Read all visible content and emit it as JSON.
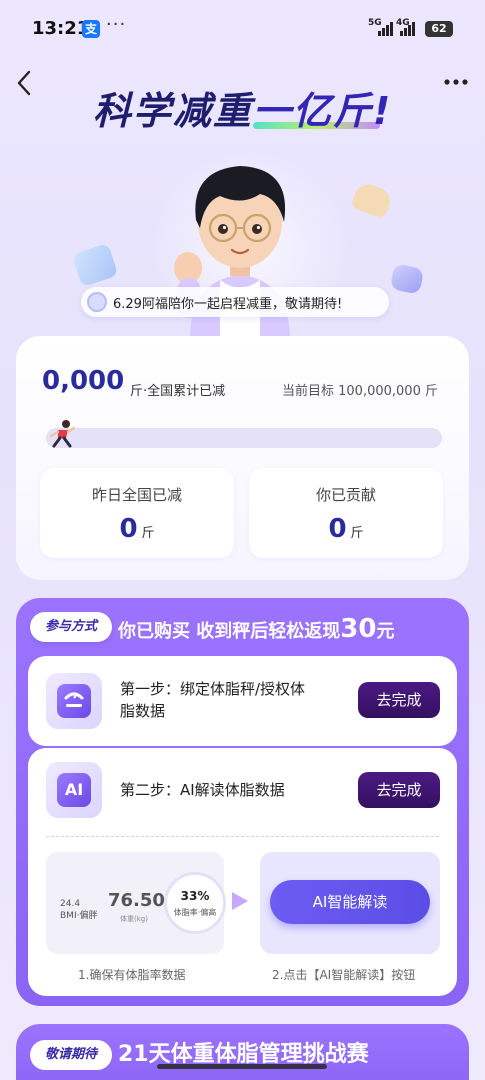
{
  "status_bar": {
    "time": "13:21",
    "app_badge": "支",
    "dots": "···",
    "net1": "5G",
    "net2": "4G",
    "battery": "62"
  },
  "hero": {
    "title_part1": "科学减重",
    "title_part2": "一亿斤!",
    "announcement": "6.29阿福陪你一起启程减重，敬请期待!"
  },
  "stats": {
    "total_value": "0,000",
    "total_unit_label": "斤·全国累计已减",
    "target_text": "当前目标 100,000,000 斤",
    "progress_fraction": 0.0,
    "yesterday_label": "昨日全国已减",
    "yesterday_value": "0",
    "yesterday_unit": "斤",
    "contributed_label": "你已贡献",
    "contributed_value": "0",
    "contributed_unit": "斤"
  },
  "participation": {
    "tag": "参与方式",
    "title_prefix": "你已购买 收到秤后轻松返现",
    "title_amount": "30",
    "title_suffix": "元",
    "step1": {
      "icon": "scale-icon",
      "text_line1": "第一步：绑定体脂秤/授权体",
      "text_line2": "脂数据",
      "button": "去完成"
    },
    "step2": {
      "icon": "ai-report-icon",
      "icon_text": "AI",
      "text_line1": "第二步：AI解读体脂数据",
      "button": "去完成"
    },
    "demo": {
      "bmi_value": "24.4",
      "bmi_label": "BMI·偏胖",
      "weight_value": "76.50",
      "weight_label": "体重(kg)",
      "fat_pct": "33%",
      "fat_label": "体脂率·偏高",
      "ai_button": "AI智能解读",
      "caption1": "1.确保有体脂率数据",
      "caption2": "2.点击【AI智能解读】按钮"
    }
  },
  "teaser": {
    "tag": "敬请期待",
    "title": "21天体重体脂管理挑战赛"
  },
  "colors": {
    "accent": "#8a64f4",
    "primary_text": "#2b2ba0",
    "button_dark": "#3d1470"
  }
}
